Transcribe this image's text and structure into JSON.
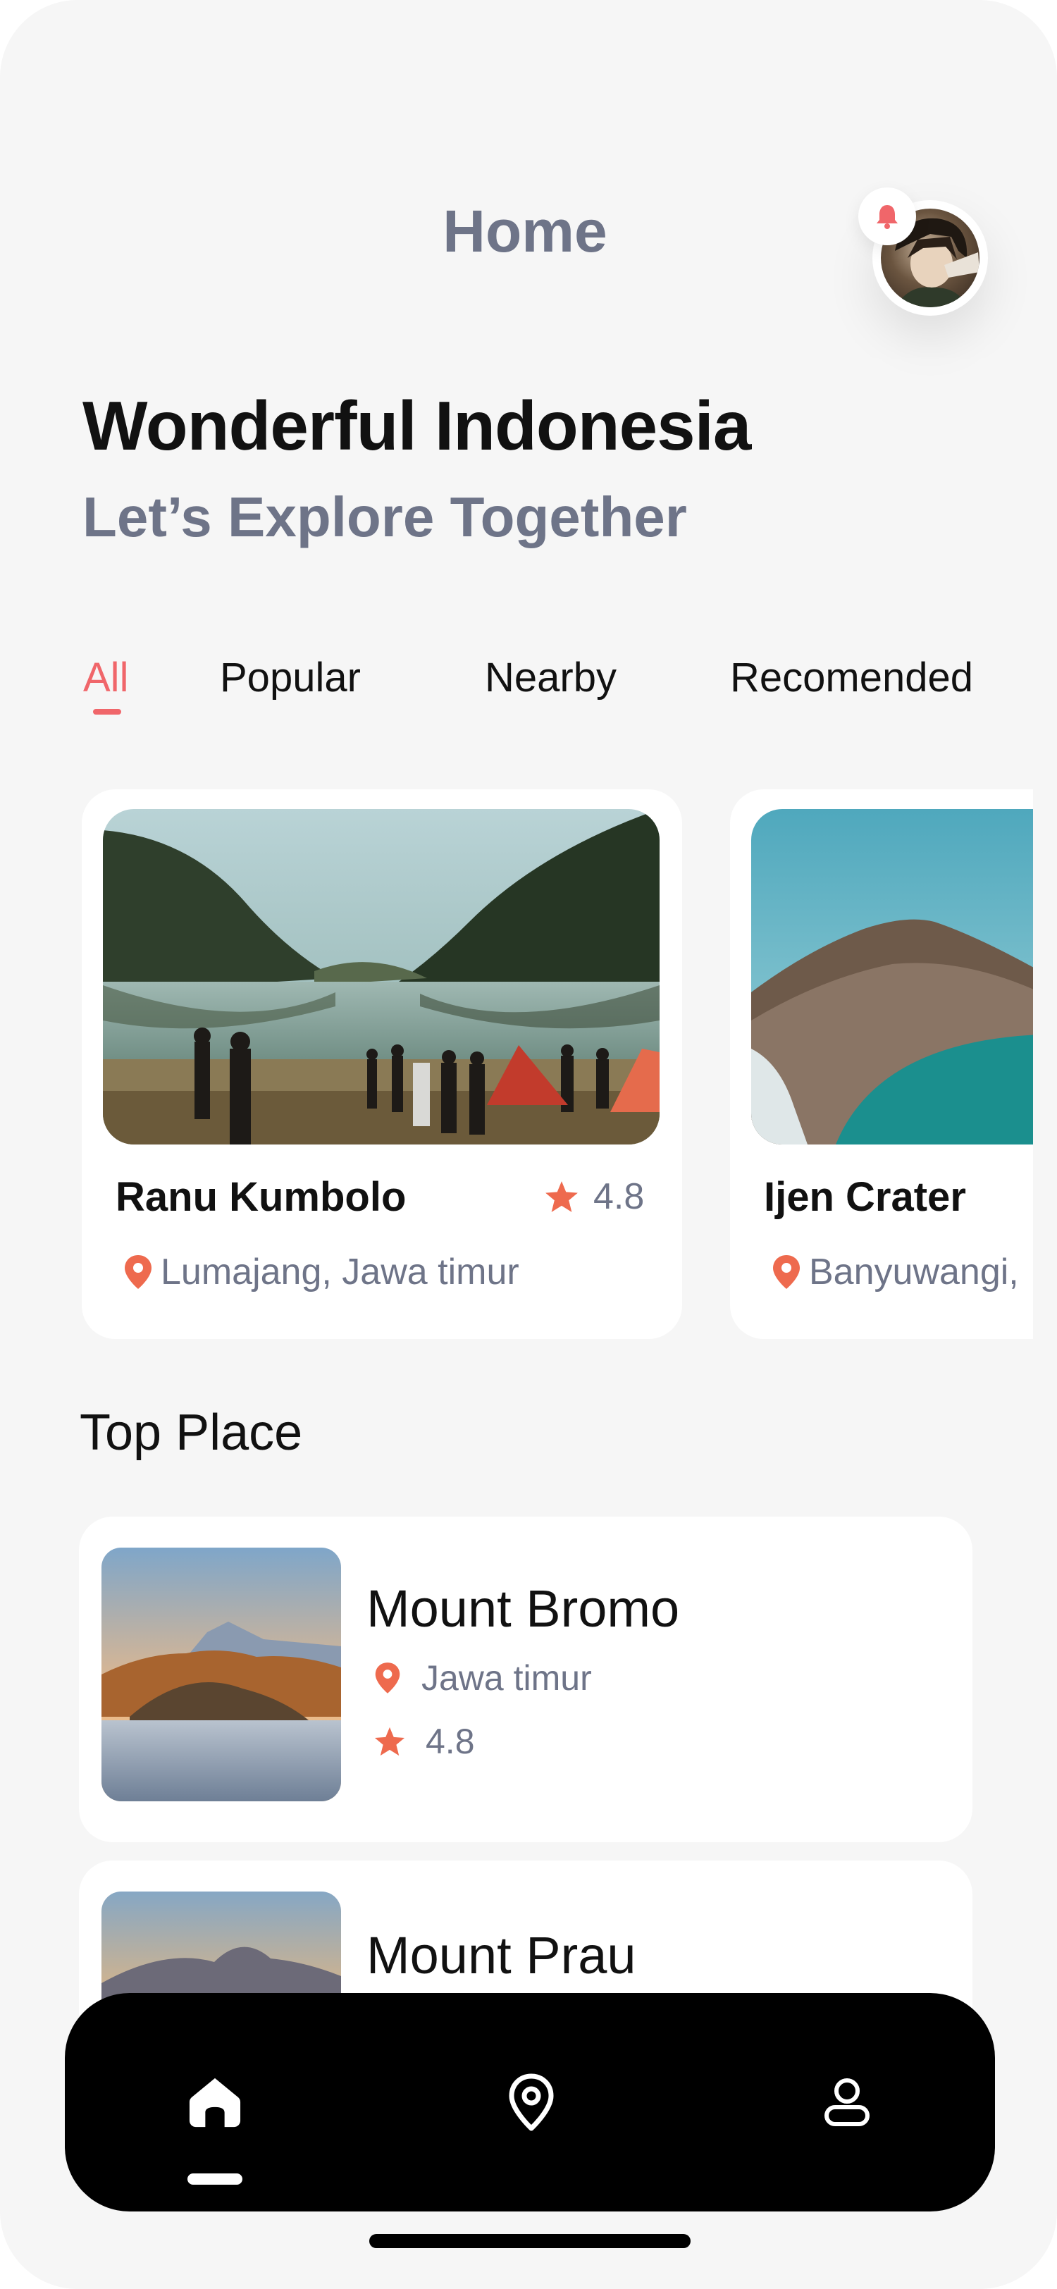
{
  "header": {
    "title": "Home"
  },
  "hero": {
    "headline": "Wonderful Indonesia",
    "subheadline": "Let’s Explore Together"
  },
  "tabs": [
    {
      "label": "All",
      "active": true
    },
    {
      "label": "Popular",
      "active": false
    },
    {
      "label": "Nearby",
      "active": false
    },
    {
      "label": "Recomended",
      "active": false
    }
  ],
  "cards": [
    {
      "name": "Ranu Kumbolo",
      "rating": "4.8",
      "location": "Lumajang, Jawa timur"
    },
    {
      "name": "Ijen Crater",
      "rating": "",
      "location": "Banyuwangi,"
    }
  ],
  "top_place": {
    "title": "Top Place",
    "items": [
      {
        "name": "Mount Bromo",
        "location": "Jawa timur",
        "rating": "4.8"
      },
      {
        "name": "Mount Prau",
        "location": "",
        "rating": ""
      }
    ]
  },
  "nav": {
    "items": [
      {
        "icon": "home-icon",
        "active": true
      },
      {
        "icon": "location-pin-icon",
        "active": false
      },
      {
        "icon": "profile-icon",
        "active": false
      }
    ]
  },
  "colors": {
    "accent": "#f0666a",
    "star": "#ee6a4e",
    "muted": "#6e7488",
    "navbar": "#000000"
  }
}
